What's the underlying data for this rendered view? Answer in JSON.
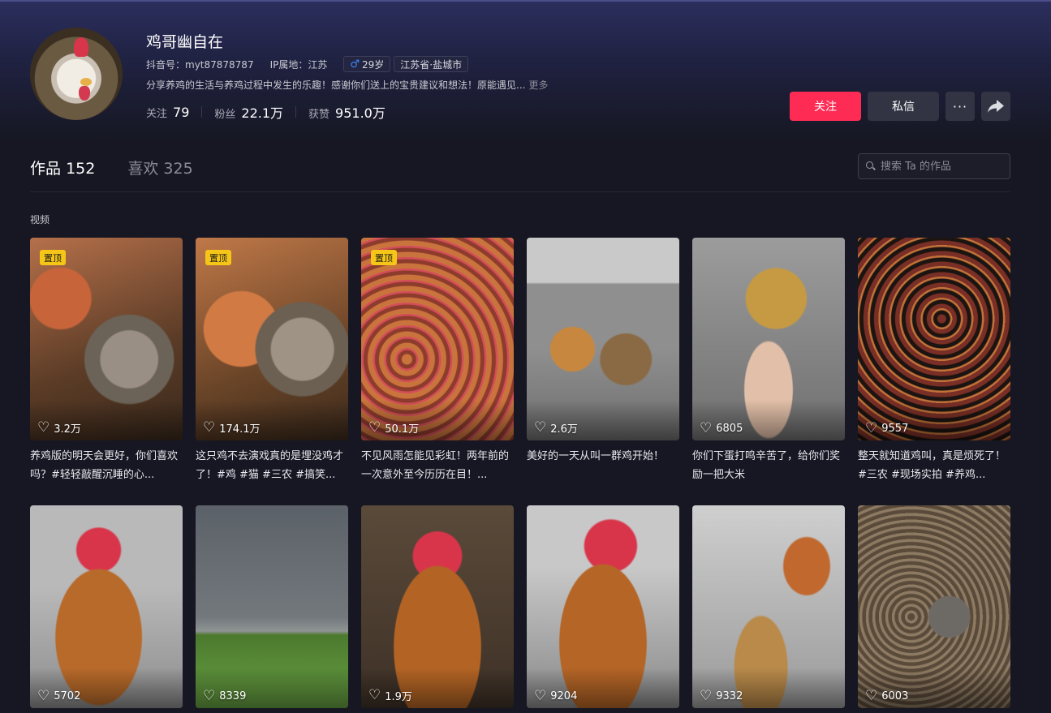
{
  "profile": {
    "name": "鸡哥幽自在",
    "douyin_id": "抖音号：myt87878787",
    "ip_location": "IP属地：江苏",
    "age": "29岁",
    "region": "江苏省·盐城市",
    "bio": "分享养鸡的生活与养鸡过程中发生的乐趣！感谢你们送上的宝贵建议和想法！原能遇见...",
    "more_label": "更多",
    "stats": {
      "following_label": "关注",
      "following_value": "79",
      "fans_label": "粉丝",
      "fans_value": "22.1万",
      "likes_label": "获赞",
      "likes_value": "951.0万"
    }
  },
  "actions": {
    "follow": "关注",
    "message": "私信",
    "more": "···",
    "share_icon": "share-arrow-icon"
  },
  "tabs": {
    "works_label": "作品",
    "works_count": "152",
    "likes_label": "喜欢",
    "likes_count": "325"
  },
  "search": {
    "placeholder": "搜索 Ta 的作品"
  },
  "section_label": "视频",
  "colors": {
    "follow_button": "#fe2c55",
    "pin_badge": "#f5c518",
    "background": "#161722"
  },
  "videos": [
    {
      "pinned": "置顶",
      "likes": "3.2万",
      "caption": "养鸡版的明天会更好，你们喜欢吗？#轻轻敲醒沉睡的心..."
    },
    {
      "pinned": "置顶",
      "likes": "174.1万",
      "caption": "这只鸡不去演戏真的是埋没鸡才了！#鸡 #猫 #三农 #搞笑..."
    },
    {
      "pinned": "置顶",
      "likes": "50.1万",
      "caption": "不见风雨怎能见彩虹！两年前的一次意外至今历历在目！..."
    },
    {
      "pinned": "",
      "likes": "2.6万",
      "caption": "美好的一天从叫一群鸡开始！"
    },
    {
      "pinned": "",
      "likes": "6805",
      "caption": "你们下蛋打鸣辛苦了，给你们奖励一把大米"
    },
    {
      "pinned": "",
      "likes": "9557",
      "caption": "整天就知道鸡叫，真是烦死了！#三农 #现场实拍 #养鸡..."
    },
    {
      "pinned": "",
      "likes": "5702",
      "caption": ""
    },
    {
      "pinned": "",
      "likes": "8339",
      "caption": ""
    },
    {
      "pinned": "",
      "likes": "1.9万",
      "caption": ""
    },
    {
      "pinned": "",
      "likes": "9204",
      "caption": ""
    },
    {
      "pinned": "",
      "likes": "9332",
      "caption": ""
    },
    {
      "pinned": "",
      "likes": "6003",
      "caption": ""
    }
  ]
}
